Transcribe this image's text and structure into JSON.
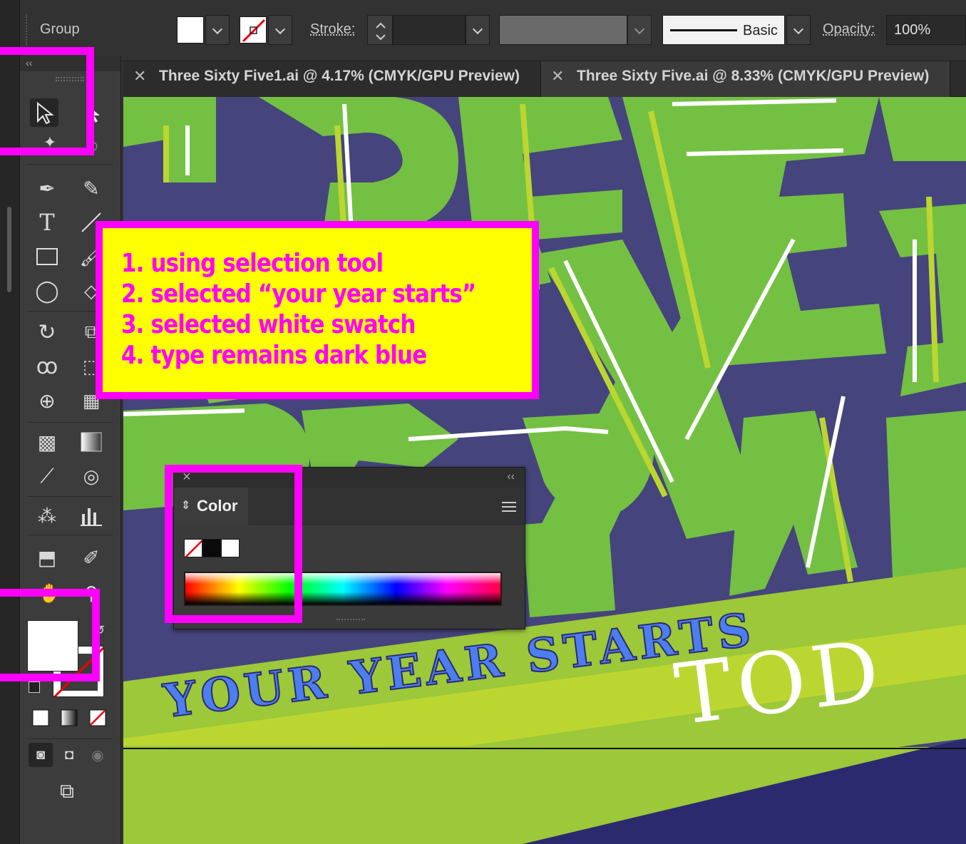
{
  "control_bar": {
    "selection_type": "Group",
    "stroke_label": "Stroke:",
    "brush_label": "Basic",
    "opacity_label": "Opacity:",
    "opacity_value": "100%"
  },
  "tabs": [
    {
      "label": "Three Sixty Five1.ai @ 4.17% (CMYK/GPU Preview)"
    },
    {
      "label": "Three Sixty Five.ai @ 8.33% (CMYK/GPU Preview)"
    }
  ],
  "toolbar": {
    "collapse_label": "‹‹"
  },
  "annotation": {
    "lines": [
      "1. using selection tool",
      "2. selected “your year starts”",
      "3. selected white swatch",
      "4. type remains dark blue"
    ],
    "highlight_color": "#ff00ff",
    "background_color": "#ffff00"
  },
  "color_panel": {
    "title": "Color",
    "collapse_label": "‹‹",
    "close_label": "×"
  },
  "artwork": {
    "banner_text": "YOUR YEAR STARTS",
    "banner_text_2": "TOD",
    "colors": {
      "green": "#74c043",
      "lime": "#bcd631",
      "navy": "#45447c",
      "deep_navy": "#2c2a6e",
      "type_blue": "#4d7ef0"
    }
  }
}
